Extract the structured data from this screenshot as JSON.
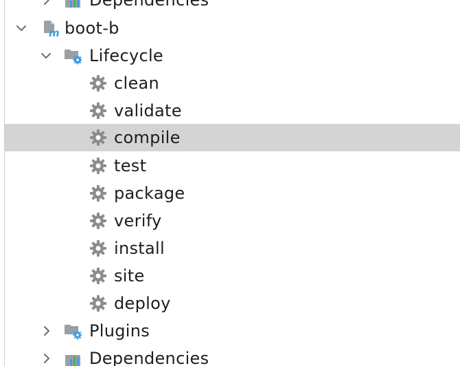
{
  "tree": {
    "top_partial": {
      "label": "Dependencies",
      "icon": "dependencies-icon"
    },
    "module": {
      "label": "boot-b",
      "icon": "maven-module-icon",
      "expanded": true
    },
    "lifecycle": {
      "label": "Lifecycle",
      "icon": "lifecycle-folder-icon",
      "expanded": true
    },
    "goals": [
      {
        "label": "clean",
        "icon": "gear-icon"
      },
      {
        "label": "validate",
        "icon": "gear-icon"
      },
      {
        "label": "compile",
        "icon": "gear-icon",
        "selected": true
      },
      {
        "label": "test",
        "icon": "gear-icon"
      },
      {
        "label": "package",
        "icon": "gear-icon"
      },
      {
        "label": "verify",
        "icon": "gear-icon"
      },
      {
        "label": "install",
        "icon": "gear-icon"
      },
      {
        "label": "site",
        "icon": "gear-icon"
      },
      {
        "label": "deploy",
        "icon": "gear-icon"
      }
    ],
    "plugins": {
      "label": "Plugins",
      "icon": "plugins-folder-icon",
      "expanded": false
    },
    "dependencies": {
      "label": "Dependencies",
      "icon": "dependencies-icon",
      "expanded": false
    }
  },
  "colors": {
    "selection": "#d4d4d4",
    "gear": "#8c8c8c",
    "folder": "#9aa0a6",
    "accent_blue": "#3d9ee6"
  }
}
